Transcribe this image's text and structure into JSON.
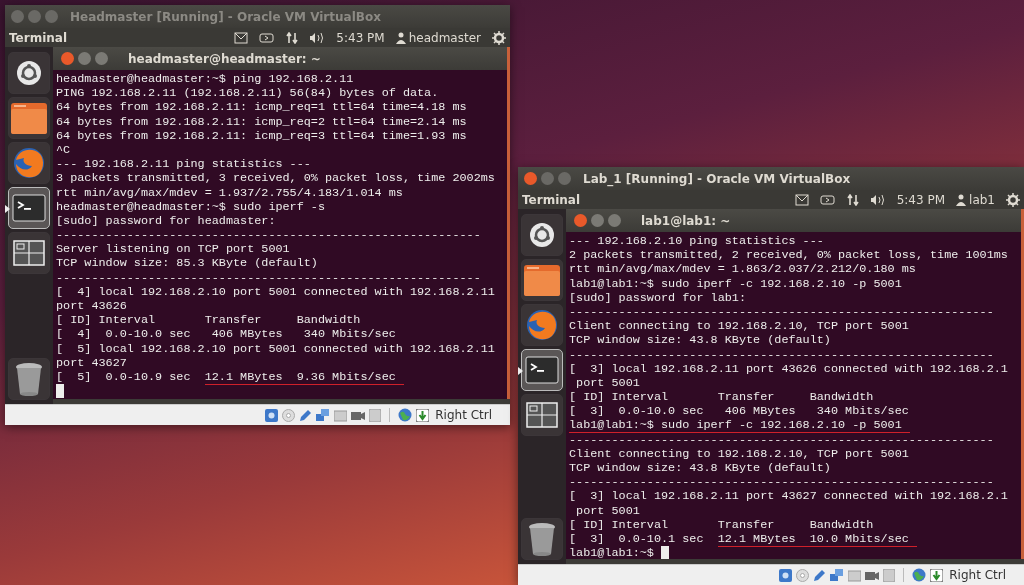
{
  "windows": [
    {
      "title": "Headmaster [Running] - Oracle VM VirtualBox",
      "focused": false,
      "menubar": {
        "app": "Terminal",
        "time": "5:43 PM",
        "user": "headmaster"
      },
      "launcher": [
        {
          "kind": "dash",
          "active": false
        },
        {
          "kind": "folder",
          "active": false
        },
        {
          "kind": "browser",
          "active": false
        },
        {
          "kind": "terminal",
          "active": true
        },
        {
          "kind": "workspaces",
          "active": false
        },
        {
          "kind": "trash",
          "active": false
        }
      ],
      "terminal": {
        "title": "headmaster@headmaster: ~",
        "lines": [
          {
            "text": "headmaster@headmaster:~$ ping 192.168.2.11"
          },
          {
            "text": "PING 192.168.2.11 (192.168.2.11) 56(84) bytes of data."
          },
          {
            "text": "64 bytes from 192.168.2.11: icmp_req=1 ttl=64 time=4.18 ms"
          },
          {
            "text": "64 bytes from 192.168.2.11: icmp_req=2 ttl=64 time=2.14 ms"
          },
          {
            "text": "64 bytes from 192.168.2.11: icmp_req=3 ttl=64 time=1.93 ms"
          },
          {
            "text": "^C"
          },
          {
            "text": "--- 192.168.2.11 ping statistics ---"
          },
          {
            "text": "3 packets transmitted, 3 received, 0% packet loss, time 2002ms"
          },
          {
            "text": "rtt min/avg/max/mdev = 1.937/2.755/4.183/1.014 ms"
          },
          {
            "text": "headmaster@headmaster:~$ sudo iperf -s"
          },
          {
            "text": "[sudo] password for headmaster:"
          },
          {
            "text": "------------------------------------------------------------"
          },
          {
            "text": "Server listening on TCP port 5001"
          },
          {
            "text": "TCP window size: 85.3 KByte (default)"
          },
          {
            "text": "------------------------------------------------------------"
          },
          {
            "text": "[  4] local 192.168.2.10 port 5001 connected with 192.168.2.11"
          },
          {
            "text": "port 43626"
          },
          {
            "text": "[ ID] Interval       Transfer     Bandwidth"
          },
          {
            "text": "[  4]  0.0-10.0 sec   406 MBytes   340 Mbits/sec"
          },
          {
            "text": "[  5] local 192.168.2.10 port 5001 connected with 192.168.2.11"
          },
          {
            "text": "port 43627"
          },
          {
            "text": "[  5]  0.0-10.9 sec  ",
            "underlined": "12.1 MBytes  9.36 Mbits/sec"
          },
          {
            "cursor": true
          }
        ]
      },
      "status_bar": {
        "host_key": "Right Ctrl"
      }
    },
    {
      "title": "Lab_1 [Running] - Oracle VM VirtualBox",
      "focused": true,
      "menubar": {
        "app": "Terminal",
        "time": "5:43 PM",
        "user": "lab1"
      },
      "launcher": [
        {
          "kind": "dash",
          "active": false
        },
        {
          "kind": "folder",
          "active": false
        },
        {
          "kind": "browser",
          "active": false
        },
        {
          "kind": "terminal",
          "active": true
        },
        {
          "kind": "workspaces",
          "active": false
        },
        {
          "kind": "trash",
          "active": false
        }
      ],
      "terminal": {
        "title": "lab1@lab1: ~",
        "lines": [
          {
            "text": "--- 192.168.2.10 ping statistics ---"
          },
          {
            "text": "2 packets transmitted, 2 received, 0% packet loss, time 1001ms"
          },
          {
            "text": "rtt min/avg/max/mdev = 1.863/2.037/2.212/0.180 ms"
          },
          {
            "text": "lab1@lab1:~$ sudo iperf -c 192.168.2.10 -p 5001"
          },
          {
            "text": "[sudo] password for lab1:"
          },
          {
            "text": "------------------------------------------------------------"
          },
          {
            "text": "Client connecting to 192.168.2.10, TCP port 5001"
          },
          {
            "text": "TCP window size: 43.8 KByte (default)"
          },
          {
            "text": "------------------------------------------------------------"
          },
          {
            "text": "[  3] local 192.168.2.11 port 43626 connected with 192.168.2.1"
          },
          {
            "text": " port 5001"
          },
          {
            "text": "[ ID] Interval       Transfer     Bandwidth"
          },
          {
            "text": "[  3]  0.0-10.0 sec   406 MBytes   340 Mbits/sec"
          },
          {
            "underlined": "lab1@lab1:~$ sudo iperf -c 192.168.2.10 -p 5001"
          },
          {
            "text": "------------------------------------------------------------"
          },
          {
            "text": "Client connecting to 192.168.2.10, TCP port 5001"
          },
          {
            "text": "TCP window size: 43.8 KByte (default)"
          },
          {
            "text": "------------------------------------------------------------"
          },
          {
            "text": "[  3] local 192.168.2.11 port 43627 connected with 192.168.2.1"
          },
          {
            "text": " port 5001"
          },
          {
            "text": "[ ID] Interval       Transfer     Bandwidth"
          },
          {
            "text": "[  3]  0.0-10.1 sec  ",
            "underlined": "12.1 MBytes  10.0 Mbits/sec"
          },
          {
            "text": "lab1@lab1:~$ ",
            "cursor": true
          }
        ]
      },
      "status_bar": {
        "host_key": "Right Ctrl"
      }
    }
  ]
}
